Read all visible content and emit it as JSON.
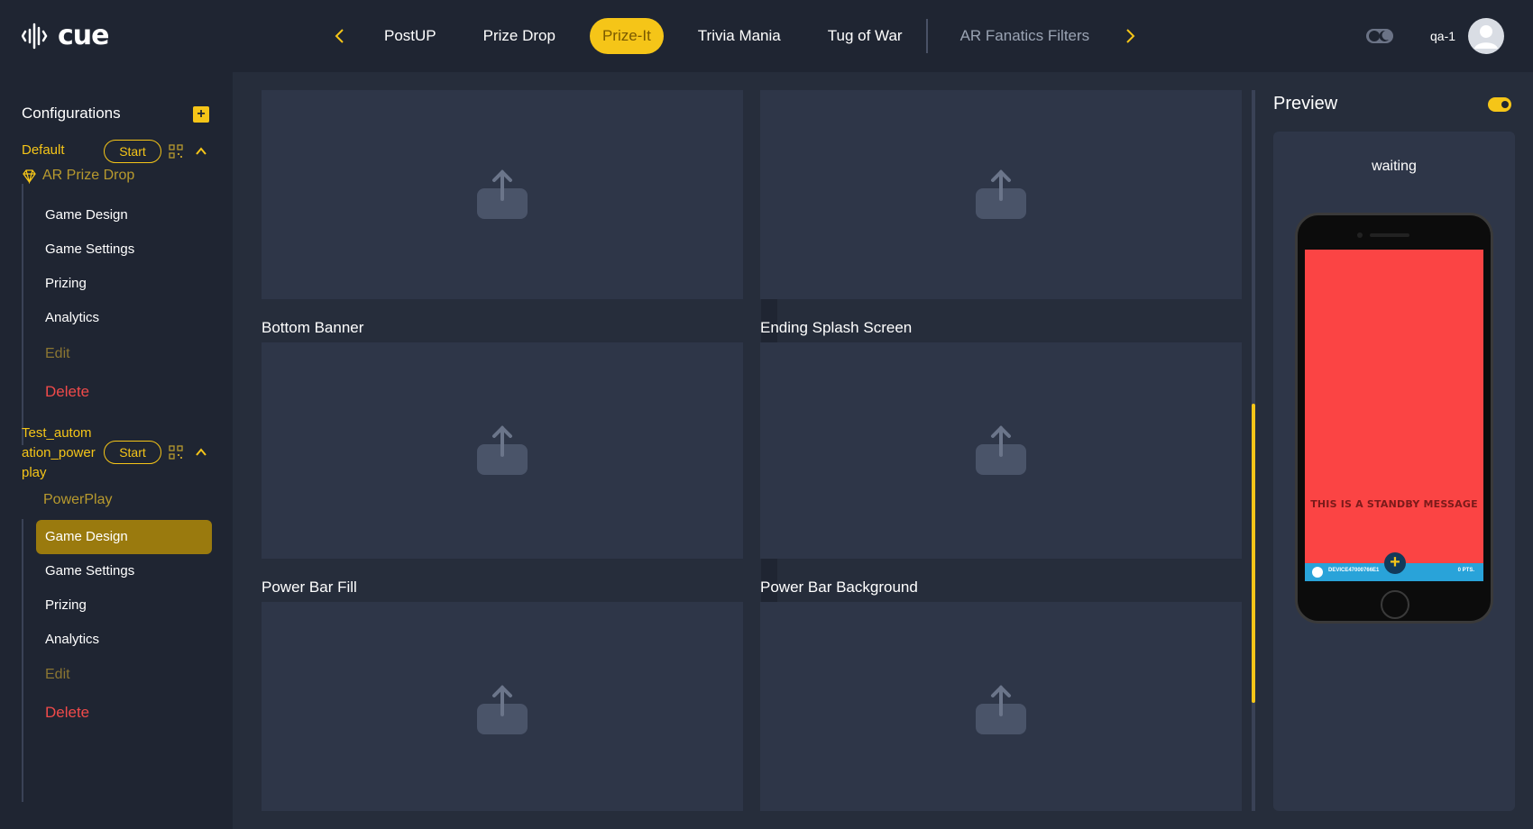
{
  "app": {
    "logo_text": "cue"
  },
  "nav": {
    "tabs": [
      {
        "label": "PostUP",
        "active": false
      },
      {
        "label": "Prize Drop",
        "active": false
      },
      {
        "label": "Prize-It",
        "active": true
      },
      {
        "label": "Trivia Mania",
        "active": false
      },
      {
        "label": "Tug of War",
        "active": false
      }
    ],
    "extra_tab": "AR Fanatics Filters",
    "prev_icon": "chevron-left-icon",
    "next_icon": "chevron-right-icon"
  },
  "user": {
    "name": "qa-1"
  },
  "sidebar": {
    "title": "Configurations",
    "configs": [
      {
        "name": "Default",
        "start_label": "Start",
        "game_type": "AR Prize Drop",
        "items": [
          "Game Design",
          "Game Settings",
          "Prizing",
          "Analytics"
        ],
        "edit_label": "Edit",
        "delete_label": "Delete"
      },
      {
        "name_lines": [
          "Test_autom",
          "ation_power",
          "play"
        ],
        "start_label": "Start",
        "game_type": "PowerPlay",
        "items": [
          "Game Design",
          "Game Settings",
          "Prizing",
          "Analytics"
        ],
        "active_item": "Game Design",
        "edit_label": "Edit",
        "delete_label": "Delete"
      }
    ]
  },
  "content": {
    "upload_labels": [
      "Bottom Banner",
      "Ending Splash Screen",
      "Power Bar Fill",
      "Power Bar Background"
    ],
    "upload_icon": "upload-icon"
  },
  "preview": {
    "title": "Preview",
    "status": "waiting",
    "standby_message": "THIS IS A STANDBY MESSAGE",
    "device_id": "DEVICE47000766E1",
    "points": "0 PTS."
  },
  "colors": {
    "accent": "#f5c518",
    "bg": "#1f2532",
    "panel": "#262d3b",
    "delete": "#f04a4a",
    "phone_screen": "#fb4444"
  }
}
